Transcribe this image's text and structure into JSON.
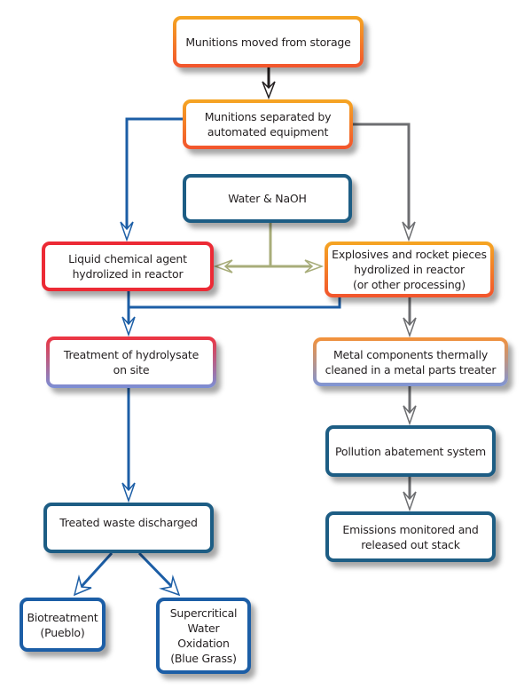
{
  "diagram": {
    "type": "flowchart",
    "colors": {
      "blue_flow": "#1c5ea6",
      "gray_flow": "#6d6e71",
      "green_flow": "#a8ad7a",
      "black_flow": "#231f20",
      "orange": "#f5a623",
      "red": "#ec2a35",
      "teal": "#1d5d84",
      "periwinkle": "#7b8fd6"
    },
    "nodes": {
      "storage": {
        "label": "Munitions moved from storage"
      },
      "separate": {
        "label": "Munitions separated by\nautomated equipment"
      },
      "water": {
        "label": "Water & NaOH"
      },
      "liquid": {
        "label": "Liquid chemical agent\nhydrolized in reactor"
      },
      "explosive": {
        "label": "Explosives and rocket pieces\nhydrolized in reactor\n(or other processing)"
      },
      "treatment": {
        "label": "Treatment of hydrolysate\non site"
      },
      "metal": {
        "label": "Metal components thermally\ncleaned in a metal parts treater"
      },
      "pollution": {
        "label": "Pollution abatement system"
      },
      "treated": {
        "label": "Treated waste discharged"
      },
      "emissions": {
        "label": "Emissions monitored and\nreleased out stack"
      },
      "bio": {
        "label": "Biotreatment\n(Pueblo)"
      },
      "scwo": {
        "label": "Supercritical\nWater\nOxidation\n(Blue Grass)"
      }
    },
    "edges": [
      {
        "from": "storage",
        "to": "separate",
        "color": "black_flow"
      },
      {
        "from": "separate",
        "to": "liquid",
        "color": "blue_flow"
      },
      {
        "from": "separate",
        "to": "explosive",
        "color": "gray_flow"
      },
      {
        "from": "water",
        "to": "liquid",
        "color": "green_flow"
      },
      {
        "from": "water",
        "to": "explosive",
        "color": "green_flow"
      },
      {
        "from": "liquid",
        "to": "treatment",
        "color": "blue_flow"
      },
      {
        "from": "explosive",
        "to": "treatment",
        "color": "blue_flow"
      },
      {
        "from": "explosive",
        "to": "metal",
        "color": "gray_flow"
      },
      {
        "from": "metal",
        "to": "pollution",
        "color": "gray_flow"
      },
      {
        "from": "pollution",
        "to": "emissions",
        "color": "gray_flow"
      },
      {
        "from": "treatment",
        "to": "treated",
        "color": "blue_flow"
      },
      {
        "from": "treated",
        "to": "bio",
        "color": "blue_flow"
      },
      {
        "from": "treated",
        "to": "scwo",
        "color": "blue_flow"
      }
    ]
  }
}
